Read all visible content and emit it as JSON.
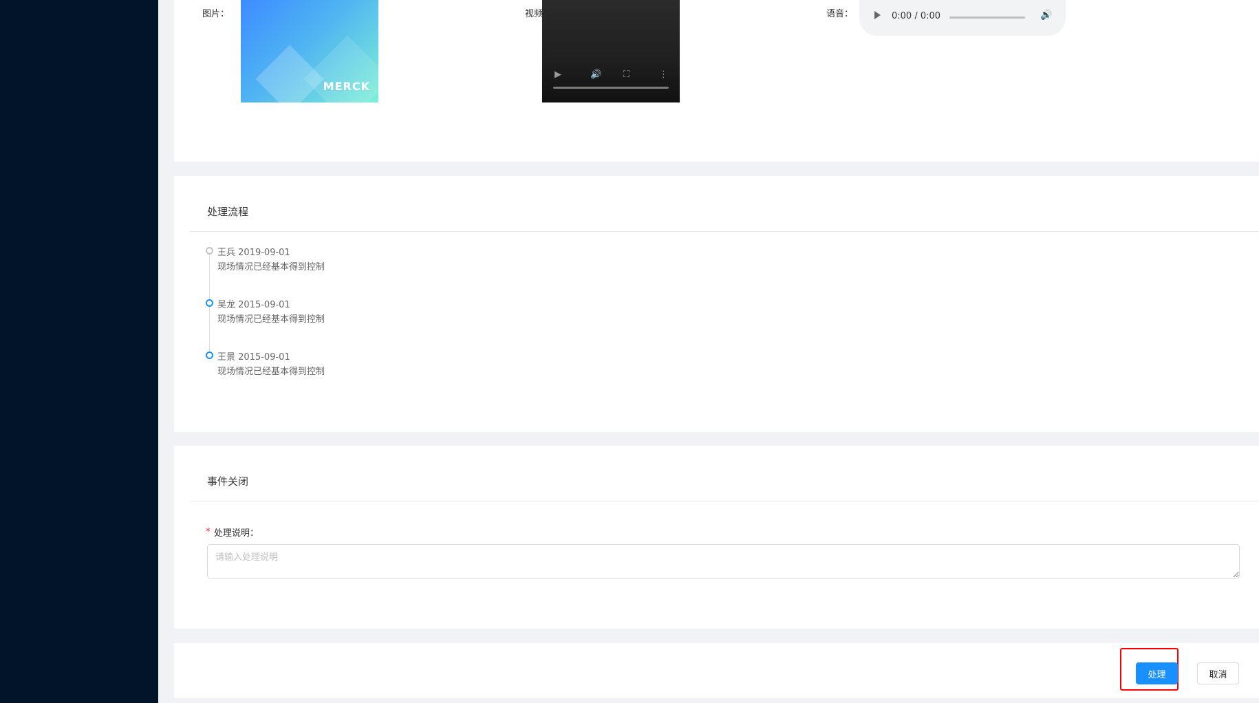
{
  "media": {
    "image_label": "图片：",
    "image_brand": "MERCK",
    "video_label": "视频：",
    "audio_label": "语音：",
    "audio_time": "0:00 / 0:00"
  },
  "process": {
    "title": "处理流程",
    "items": [
      {
        "person": "王兵",
        "date": "2019-09-01",
        "desc": "现场情况已经基本得到控制",
        "dot_color": "#c0c4cc"
      },
      {
        "person": "吴龙",
        "date": "2015-09-01",
        "desc": "现场情况已经基本得到控制",
        "dot_color": "#1890ff"
      },
      {
        "person": "王景",
        "date": "2015-09-01",
        "desc": "现场情况已经基本得到控制",
        "dot_color": "#1890ff"
      }
    ]
  },
  "close": {
    "title": "事件关闭",
    "required_mark": "*",
    "field_label": "处理说明：",
    "placeholder": "请输入处理说明",
    "value": ""
  },
  "actions": {
    "submit_label": "处理",
    "cancel_label": "取消"
  },
  "colors": {
    "sidebar": "#021428",
    "primary": "#1890ff",
    "background": "#f0f2f5",
    "highlight": "#ff0000"
  }
}
